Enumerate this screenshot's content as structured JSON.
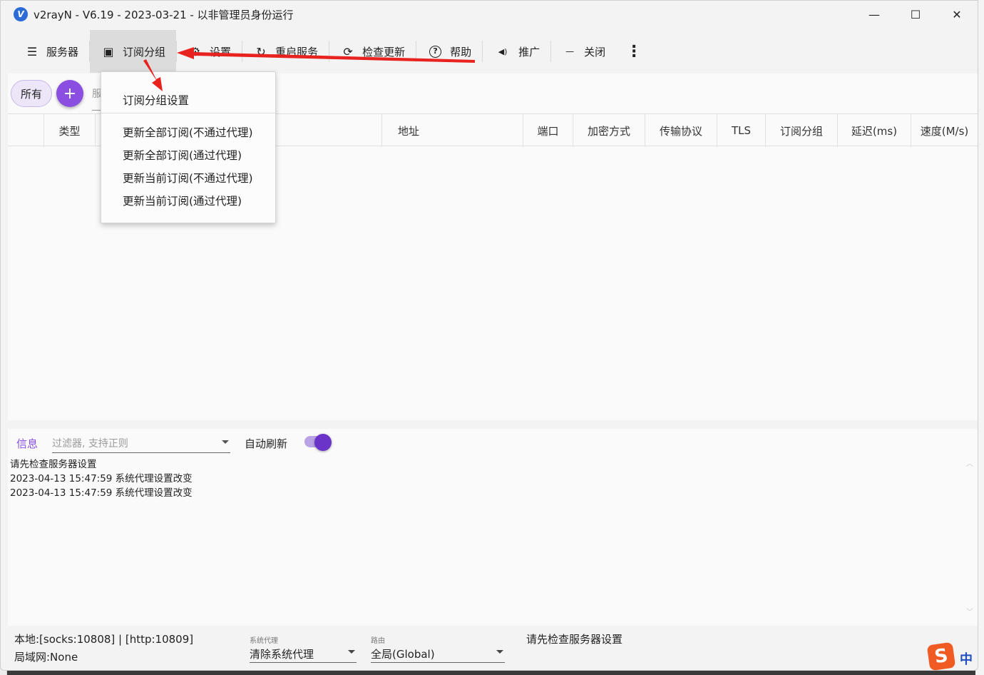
{
  "window": {
    "title": "v2rayN - V6.19 - 2023-03-21 - 以非管理员身份运行",
    "logo_letter": "V",
    "min_glyph": "—",
    "max_glyph": "☐",
    "close_glyph": "✕"
  },
  "toolbar": {
    "items": [
      {
        "label": "服务器",
        "icon": "server-icon"
      },
      {
        "label": "订阅分组",
        "icon": "subscription-icon"
      },
      {
        "label": "设置",
        "icon": "gear-icon"
      },
      {
        "label": "重启服务",
        "icon": "restart-icon"
      },
      {
        "label": "检查更新",
        "icon": "update-icon"
      },
      {
        "label": "帮助",
        "icon": "help-icon"
      },
      {
        "label": "推广",
        "icon": "speaker-icon"
      },
      {
        "label": "关闭",
        "icon": "minus-icon"
      }
    ],
    "more_glyph": "⋮",
    "glyphs": {
      "server": "☰",
      "subscription": "▣",
      "gear": "⚙",
      "restart": "↻",
      "update": "⟳",
      "help": "?",
      "speaker": "◀)",
      "minus": "—"
    }
  },
  "groups": {
    "all_label": "所有",
    "add_glyph": "+",
    "search_peek": "服"
  },
  "grid": {
    "columns": [
      "类型",
      "地址",
      "端口",
      "加密方式",
      "传输协议",
      "TLS",
      "订阅分组",
      "延迟(ms)",
      "速度(M/s)"
    ]
  },
  "sub_menu": {
    "items": [
      "订阅分组设置",
      "更新全部订阅(不通过代理)",
      "更新全部订阅(通过代理)",
      "更新当前订阅(不通过代理)",
      "更新当前订阅(通过代理)"
    ]
  },
  "log": {
    "tab_label": "信息",
    "filter_placeholder": "过滤器, 支持正则",
    "auto_refresh_label": "自动刷新",
    "auto_refresh_on": true,
    "lines": [
      "请先检查服务器设置",
      "2023-04-13 15:47:59 系统代理设置改变",
      "2023-04-13 15:47:59 系统代理设置改变"
    ],
    "scroll_up_glyph": "︿",
    "scroll_down_glyph": "﹀"
  },
  "status": {
    "local": "本地:[socks:10808] | [http:10809]",
    "lan": "局域网:None",
    "sysproxy_caption": "系统代理",
    "sysproxy_value": "清除系统代理",
    "routing_caption": "路由",
    "routing_value": "全局(Global)",
    "message": "请先检查服务器设置"
  },
  "ime": {
    "logo": "S",
    "mode": "中"
  },
  "colors": {
    "accent": "#8a4fe0",
    "arrow": "#e8231f"
  }
}
